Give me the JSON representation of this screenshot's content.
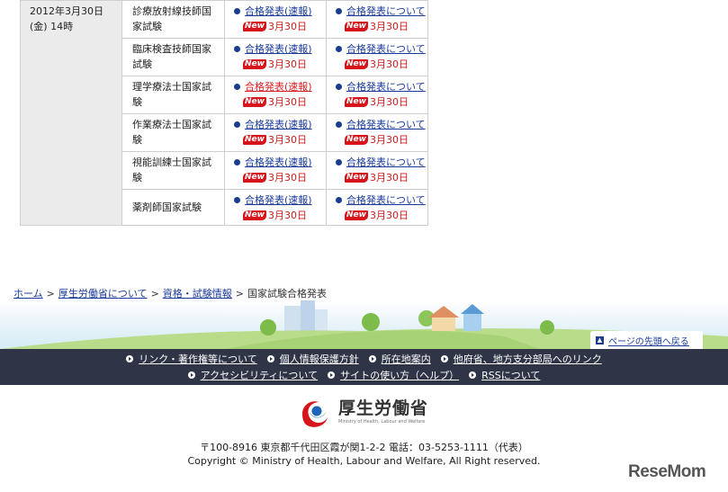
{
  "table": {
    "date": "2012年3月30日 (金) 14時",
    "rows": [
      {
        "name": "診療放射線技師国家試験",
        "quick": "合格発表(速報)",
        "about": "合格発表について",
        "new_label": "New",
        "date": "3月30日"
      },
      {
        "name": "臨床検査技師国家試験",
        "quick": "合格発表(速報)",
        "about": "合格発表について",
        "new_label": "New",
        "date": "3月30日"
      },
      {
        "name": "理学療法士国家試験",
        "quick": "合格発表(速報)",
        "about": "合格発表について",
        "new_label": "New",
        "date": "3月30日"
      },
      {
        "name": "作業療法士国家試験",
        "quick": "合格発表(速報)",
        "about": "合格発表について",
        "new_label": "New",
        "date": "3月30日"
      },
      {
        "name": "視能訓練士国家試験",
        "quick": "合格発表(速報)",
        "about": "合格発表について",
        "new_label": "New",
        "date": "3月30日"
      },
      {
        "name": "薬剤師国家試験",
        "quick": "合格発表(速報)",
        "about": "合格発表について",
        "new_label": "New",
        "date": "3月30日"
      }
    ]
  },
  "breadcrumb": {
    "items": [
      "ホーム",
      "厚生労働省について",
      "資格・試験情報"
    ],
    "separator": ">",
    "current": "国家試験合格発表"
  },
  "page_top": "ページの先頭へ戻る",
  "footer_nav": {
    "row1": [
      "リンク・著作権等について",
      "個人情報保護方針",
      "所在地案内",
      "他府省、地方支分部局へのリンク"
    ],
    "row2": [
      "アクセシビリティについて",
      "サイトの使い方（ヘルプ）",
      "RSSについて"
    ]
  },
  "logo": {
    "jp": "厚生労働省",
    "en": "Ministry of Health, Labour and Welfare"
  },
  "address": "〒100-8916 東京都千代田区霞が関1-2-2 電話：03-5253-1111（代表）",
  "copyright": "Copyright © Ministry of Health, Labour and Welfare, All Right reserved.",
  "watermark": "ReseMom",
  "colors": {
    "link": "#1a3b9c",
    "red": "#d81d24",
    "footer_bg": "#2f3446",
    "date_bg": "#ebebeb"
  }
}
